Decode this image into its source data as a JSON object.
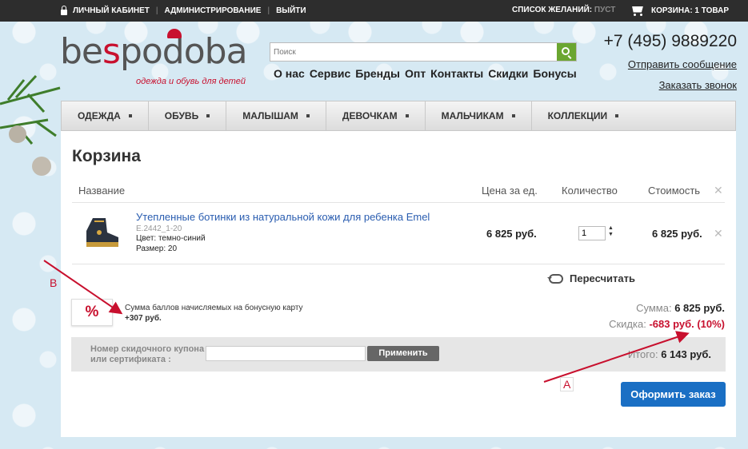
{
  "topbar": {
    "account": "Личный кабинет",
    "admin": "Администрирование",
    "logout": "Выйти",
    "wishlist_label": "Список желаний:",
    "wishlist_value": "пуст",
    "cart_label": "Корзина: 1 товар"
  },
  "logo": {
    "text_pre": "be",
    "text_s": "s",
    "text_post": "podoba",
    "tagline": "одежда и обувь для детей"
  },
  "search": {
    "placeholder": "Поиск"
  },
  "mainnav": [
    "О нас",
    "Сервис",
    "Бренды",
    "Опт",
    "Контакты",
    "Скидки",
    "Бонусы"
  ],
  "header": {
    "phone": "+7 (495) 9889220",
    "send_message": "Отправить сообщение",
    "order_call": "Заказать звонок"
  },
  "categories": [
    "Одежда",
    "Обувь",
    "Малышам",
    "Девочкам",
    "Мальчикам",
    "Коллекции"
  ],
  "cart": {
    "title": "Корзина",
    "columns": {
      "name": "Название",
      "unit_price": "Цена за ед.",
      "quantity": "Количество",
      "total": "Стоимость"
    },
    "items": [
      {
        "name": "Утепленные ботинки из натуральной кожи для ребенка Emel",
        "sku": "E.2442_1-20",
        "color": "Цвет: темно-синий",
        "size": "Размер: 20",
        "unit_price": "6 825 руб.",
        "quantity": "1",
        "total": "6 825 руб."
      }
    ],
    "recalc": "Пересчитать",
    "bonus_symbol": "%",
    "bonus_text": "Сумма баллов начисляемых на бонусную карту",
    "bonus_value": "+307 руб.",
    "sum_label": "Сумма:",
    "sum_value": "6 825 руб.",
    "discount_label": "Скидка:",
    "discount_value": "-683 руб. (10%)",
    "coupon_label_1": "Номер скидочного купона",
    "coupon_label_2": "или сертификата :",
    "apply": "Применить",
    "total_label": "Итого:",
    "total_value": "6 143 руб.",
    "checkout": "Оформить заказ"
  },
  "annotations": {
    "a": "A",
    "b": "B"
  },
  "colors": {
    "accent_red": "#c8102e",
    "link_blue": "#2a5db0",
    "button_blue": "#1a6fc4",
    "search_green": "#6aa630"
  }
}
